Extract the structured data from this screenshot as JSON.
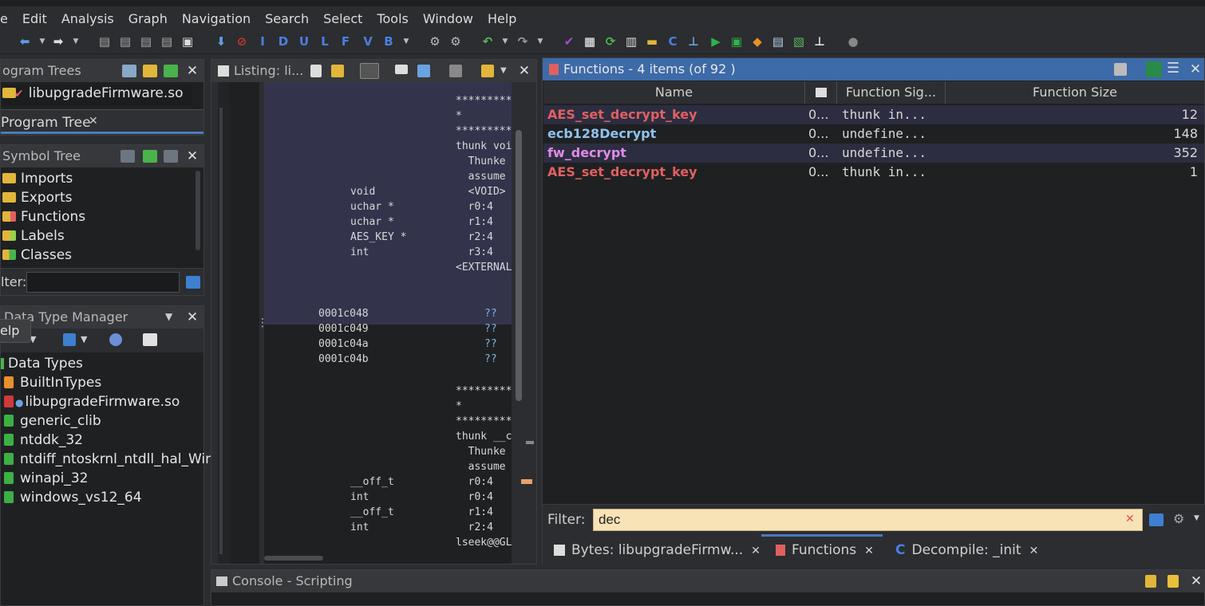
{
  "menu": [
    "e",
    "Edit",
    "Analysis",
    "Graph",
    "Navigation",
    "Search",
    "Select",
    "Tools",
    "Window",
    "Help"
  ],
  "toolbar": {
    "letters": [
      "I",
      "D",
      "U",
      "L",
      "F",
      "V",
      "B"
    ]
  },
  "program_trees": {
    "title": "ogram Trees",
    "file": "libupgradeFirmware.so",
    "tab": "Program Tree"
  },
  "symbol_tree": {
    "title": "Symbol Tree",
    "items": [
      "Imports",
      "Exports",
      "Functions",
      "Labels",
      "Classes"
    ],
    "filter_label": "lter:",
    "filter_value": ""
  },
  "data_type_manager": {
    "title": "Data Type Manager",
    "tooltip": "elp",
    "root": "Data Types",
    "items": [
      "BuiltInTypes",
      "libupgradeFirmware.so",
      "generic_clib",
      "ntddk_32",
      "ntdiff_ntoskrnl_ntdll_hal_Win",
      "winapi_32",
      "windows_vs12_64"
    ]
  },
  "listing": {
    "title": "Listing:  li...",
    "lines": [
      {
        "c1": "",
        "c2": "*********",
        "cls": "g"
      },
      {
        "c1": "",
        "c2": "*",
        "cls": "g"
      },
      {
        "c1": "",
        "c2": "*********",
        "cls": "g"
      },
      {
        "c1": "",
        "c2": "thunk voi",
        "cls": ""
      },
      {
        "c1": "",
        "c2": "  Thunke",
        "cls": "g"
      },
      {
        "c1": "",
        "c2": "  assume",
        "cls": "g"
      },
      {
        "c1": "void",
        "c2": "  <VOID>",
        "cls": "g"
      },
      {
        "c1": "uchar *",
        "c2": "  r0:4",
        "cls": "g"
      },
      {
        "c1": "uchar *",
        "c2": "  r1:4",
        "cls": "g"
      },
      {
        "c1": "AES_KEY *",
        "c2": "  r2:4",
        "cls": "g"
      },
      {
        "c1": "int",
        "c2": "  r3:4",
        "cls": "g"
      },
      {
        "c1": "",
        "c2": "<EXTERNAL",
        "cls": "r"
      }
    ],
    "bytes": [
      {
        "addr": "0001c048",
        "val": "??"
      },
      {
        "addr": "0001c049",
        "val": "??"
      },
      {
        "addr": "0001c04a",
        "val": "??"
      },
      {
        "addr": "0001c04b",
        "val": "??"
      }
    ],
    "lines2": [
      {
        "c1": "",
        "c2": "*********",
        "cls": "g"
      },
      {
        "c1": "",
        "c2": "*",
        "cls": "g"
      },
      {
        "c1": "",
        "c2": "*********",
        "cls": "g"
      },
      {
        "c1": "",
        "c2": "thunk __c",
        "cls": ""
      },
      {
        "c1": "",
        "c2": "  Thunke",
        "cls": "g"
      },
      {
        "c1": "",
        "c2": "  assume",
        "cls": "g"
      },
      {
        "c1": "__off_t",
        "c2": "  r0:4",
        "cls": "g"
      },
      {
        "c1": "int",
        "c2": "  r0:4",
        "cls": "g"
      },
      {
        "c1": "__off_t",
        "c2": "  r1:4",
        "cls": "g"
      },
      {
        "c1": "int",
        "c2": "  r2:4",
        "cls": "g"
      },
      {
        "c1": "",
        "c2": "lseek@@GL",
        "cls": "m"
      }
    ]
  },
  "functions": {
    "title": "Functions - 4 items (of 92 )",
    "columns": [
      "Name",
      "",
      "Function Sig...",
      "Function Size"
    ],
    "rows": [
      {
        "name": "AES_set_decrypt_key",
        "addr": "0...",
        "sig": "thunk in...",
        "size": "12",
        "color": "#e06060"
      },
      {
        "name": "ecb128Decrypt",
        "addr": "0...",
        "sig": "undefine...",
        "size": "148",
        "color": "#8ec3f0"
      },
      {
        "name": "fw_decrypt",
        "addr": "0...",
        "sig": "undefine...",
        "size": "352",
        "color": "#e28ae8"
      },
      {
        "name": "AES_set_decrypt_key",
        "addr": "0...",
        "sig": "thunk in...",
        "size": "1",
        "color": "#e06060"
      }
    ],
    "filter_label": "Filter:",
    "filter_value": "dec"
  },
  "bottom_tabs": [
    "Bytes: libupgradeFirmw...",
    "Functions",
    "Decompile: _init"
  ],
  "console": {
    "title": "Console - Scripting"
  }
}
